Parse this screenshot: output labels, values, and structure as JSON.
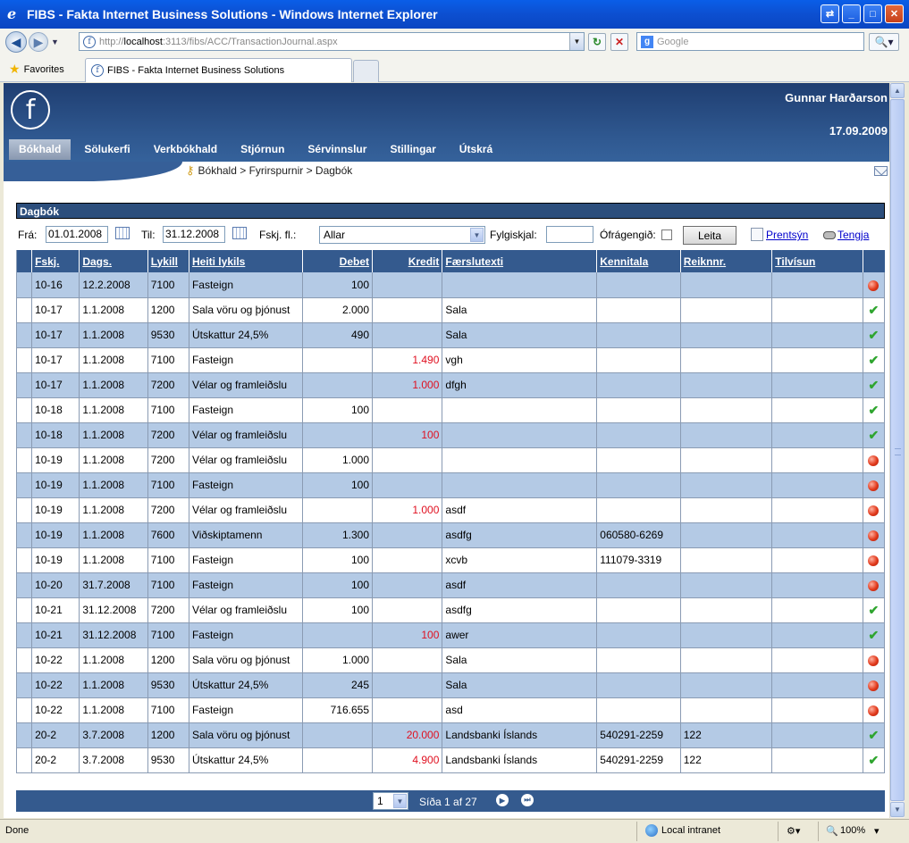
{
  "window": {
    "title": "FIBS - Fakta Internet Business Solutions - Windows Internet Explorer"
  },
  "browser": {
    "url_prefix": "http://",
    "url_host": "localhost",
    "url_rest": ":3113/fibs/ACC/TransactionJournal.aspx",
    "search_placeholder": "Google",
    "favorites_label": "Favorites",
    "tab_title": "FIBS - Fakta Internet Business Solutions"
  },
  "app": {
    "logo_letter": "f",
    "user_name": "Gunnar Harðarson",
    "date": "17.09.2009",
    "menu": [
      {
        "label": "Bókhald",
        "active": true
      },
      {
        "label": "Sölukerfi"
      },
      {
        "label": "Verkbókhald"
      },
      {
        "label": "Stjórnun"
      },
      {
        "label": "Sérvinnslur"
      },
      {
        "label": "Stillingar"
      },
      {
        "label": "Útskrá"
      }
    ],
    "breadcrumb": "Bókhald > Fyrirspurnir > Dagbók"
  },
  "section_title": "Dagbók",
  "filters": {
    "from_label": "Frá:",
    "from_value": "01.01.2008",
    "to_label": "Til:",
    "to_value": "31.12.2008",
    "type_label": "Fskj. fl.:",
    "type_value": "Allar",
    "doc_label": "Fylgiskjal:",
    "doc_value": "",
    "unposted_label": "Ófrágengið:",
    "search_button": "Leita",
    "print_link": "Prentsýn",
    "connect_link": "Tengja"
  },
  "table": {
    "headers": [
      "Fskj.",
      "Dags.",
      "Lykill",
      "Heiti lykils",
      "Debet",
      "Kredit",
      "Færslutexti",
      "Kennitala",
      "Reiknnr.",
      "Tilvísun"
    ],
    "rows": [
      {
        "fskj": "10-16",
        "dags": "12.2.2008",
        "lykill": "7100",
        "heiti": "Fasteign",
        "debet": "100",
        "kredit": "",
        "texti": "",
        "kennitala": "",
        "reiknnr": "",
        "tilvisun": "",
        "status": "error"
      },
      {
        "fskj": "10-17",
        "dags": "1.1.2008",
        "lykill": "1200",
        "heiti": "Sala vöru og þjónust",
        "debet": "2.000",
        "kredit": "",
        "texti": "Sala",
        "kennitala": "",
        "reiknnr": "",
        "tilvisun": "",
        "status": "ok"
      },
      {
        "fskj": "10-17",
        "dags": "1.1.2008",
        "lykill": "9530",
        "heiti": "Útskattur 24,5%",
        "debet": "490",
        "kredit": "",
        "texti": "Sala",
        "kennitala": "",
        "reiknnr": "",
        "tilvisun": "",
        "status": "ok"
      },
      {
        "fskj": "10-17",
        "dags": "1.1.2008",
        "lykill": "7100",
        "heiti": "Fasteign",
        "debet": "",
        "kredit": "1.490",
        "texti": "vgh",
        "kennitala": "",
        "reiknnr": "",
        "tilvisun": "",
        "status": "ok"
      },
      {
        "fskj": "10-17",
        "dags": "1.1.2008",
        "lykill": "7200",
        "heiti": "Vélar og framleiðslu",
        "debet": "",
        "kredit": "1.000",
        "texti": "dfgh",
        "kennitala": "",
        "reiknnr": "",
        "tilvisun": "",
        "status": "ok"
      },
      {
        "fskj": "10-18",
        "dags": "1.1.2008",
        "lykill": "7100",
        "heiti": "Fasteign",
        "debet": "100",
        "kredit": "",
        "texti": "",
        "kennitala": "",
        "reiknnr": "",
        "tilvisun": "",
        "status": "ok"
      },
      {
        "fskj": "10-18",
        "dags": "1.1.2008",
        "lykill": "7200",
        "heiti": "Vélar og framleiðslu",
        "debet": "",
        "kredit": "100",
        "texti": "",
        "kennitala": "",
        "reiknnr": "",
        "tilvisun": "",
        "status": "ok"
      },
      {
        "fskj": "10-19",
        "dags": "1.1.2008",
        "lykill": "7200",
        "heiti": "Vélar og framleiðslu",
        "debet": "1.000",
        "kredit": "",
        "texti": "",
        "kennitala": "",
        "reiknnr": "",
        "tilvisun": "",
        "status": "error"
      },
      {
        "fskj": "10-19",
        "dags": "1.1.2008",
        "lykill": "7100",
        "heiti": "Fasteign",
        "debet": "100",
        "kredit": "",
        "texti": "",
        "kennitala": "",
        "reiknnr": "",
        "tilvisun": "",
        "status": "error"
      },
      {
        "fskj": "10-19",
        "dags": "1.1.2008",
        "lykill": "7200",
        "heiti": "Vélar og framleiðslu",
        "debet": "",
        "kredit": "1.000",
        "texti": "asdf",
        "kennitala": "",
        "reiknnr": "",
        "tilvisun": "",
        "status": "error"
      },
      {
        "fskj": "10-19",
        "dags": "1.1.2008",
        "lykill": "7600",
        "heiti": "Viðskiptamenn",
        "debet": "1.300",
        "kredit": "",
        "texti": "asdfg",
        "kennitala": "060580-6269",
        "reiknnr": "",
        "tilvisun": "",
        "status": "error"
      },
      {
        "fskj": "10-19",
        "dags": "1.1.2008",
        "lykill": "7100",
        "heiti": "Fasteign",
        "debet": "100",
        "kredit": "",
        "texti": "xcvb",
        "kennitala": "111079-3319",
        "reiknnr": "",
        "tilvisun": "",
        "status": "error"
      },
      {
        "fskj": "10-20",
        "dags": "31.7.2008",
        "lykill": "7100",
        "heiti": "Fasteign",
        "debet": "100",
        "kredit": "",
        "texti": "asdf",
        "kennitala": "",
        "reiknnr": "",
        "tilvisun": "",
        "status": "error"
      },
      {
        "fskj": "10-21",
        "dags": "31.12.2008",
        "lykill": "7200",
        "heiti": "Vélar og framleiðslu",
        "debet": "100",
        "kredit": "",
        "texti": "asdfg",
        "kennitala": "",
        "reiknnr": "",
        "tilvisun": "",
        "status": "ok"
      },
      {
        "fskj": "10-21",
        "dags": "31.12.2008",
        "lykill": "7100",
        "heiti": "Fasteign",
        "debet": "",
        "kredit": "100",
        "texti": "awer",
        "kennitala": "",
        "reiknnr": "",
        "tilvisun": "",
        "status": "ok"
      },
      {
        "fskj": "10-22",
        "dags": "1.1.2008",
        "lykill": "1200",
        "heiti": "Sala vöru og þjónust",
        "debet": "1.000",
        "kredit": "",
        "texti": "Sala",
        "kennitala": "",
        "reiknnr": "",
        "tilvisun": "",
        "status": "error"
      },
      {
        "fskj": "10-22",
        "dags": "1.1.2008",
        "lykill": "9530",
        "heiti": "Útskattur 24,5%",
        "debet": "245",
        "kredit": "",
        "texti": "Sala",
        "kennitala": "",
        "reiknnr": "",
        "tilvisun": "",
        "status": "error"
      },
      {
        "fskj": "10-22",
        "dags": "1.1.2008",
        "lykill": "7100",
        "heiti": "Fasteign",
        "debet": "716.655",
        "kredit": "",
        "texti": "asd",
        "kennitala": "",
        "reiknnr": "",
        "tilvisun": "",
        "status": "error"
      },
      {
        "fskj": "20-2",
        "dags": "3.7.2008",
        "lykill": "1200",
        "heiti": "Sala vöru og þjónust",
        "debet": "",
        "kredit": "20.000",
        "texti": "Landsbanki Íslands",
        "kennitala": "540291-2259",
        "reiknnr": "122",
        "tilvisun": "",
        "status": "ok"
      },
      {
        "fskj": "20-2",
        "dags": "3.7.2008",
        "lykill": "9530",
        "heiti": "Útskattur 24,5%",
        "debet": "",
        "kredit": "4.900",
        "texti": "Landsbanki Íslands",
        "kennitala": "540291-2259",
        "reiknnr": "122",
        "tilvisun": "",
        "status": "ok"
      }
    ]
  },
  "pager": {
    "page_value": "1",
    "page_text": "Síða 1 af 27"
  },
  "status": {
    "left": "Done",
    "zone": "Local intranet",
    "zoom": "100%"
  },
  "colors": {
    "header_blue": "#345a8e",
    "row_alt": "#b4cae5",
    "credit_red": "#e01020"
  }
}
